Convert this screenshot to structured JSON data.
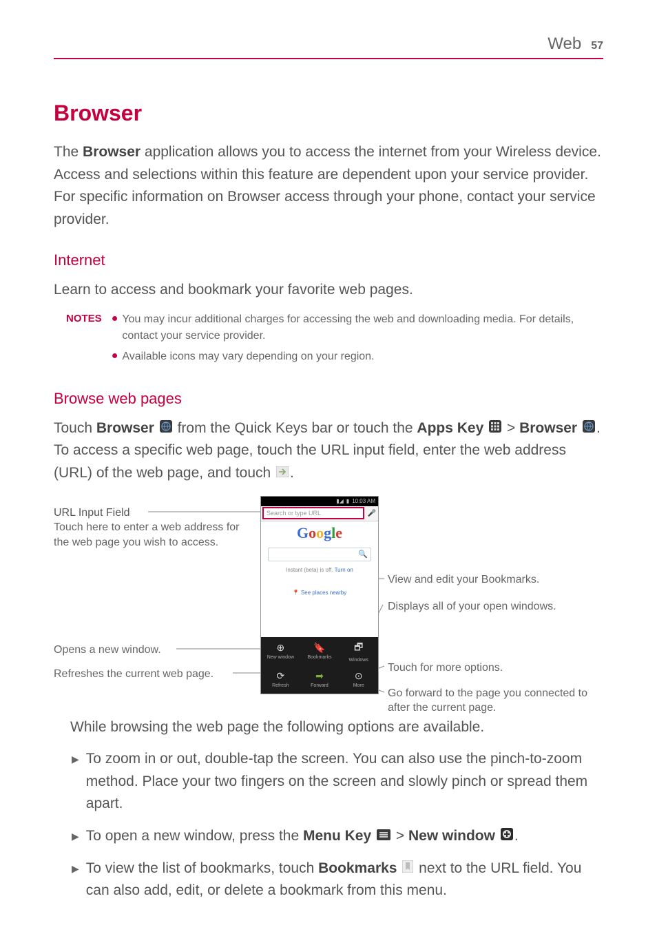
{
  "header": {
    "section": "Web",
    "page": "57"
  },
  "title": "Browser",
  "intro_parts": {
    "p1": "The ",
    "kw1": "Browser",
    "p2": " application allows you to access the internet from your Wireless device. Access and selections within this feature are dependent upon your service provider. For specific information on Browser access through your phone, contact your service provider."
  },
  "internet": {
    "heading": "Internet",
    "body": "Learn to access and bookmark your favorite web pages."
  },
  "notes": {
    "label": "NOTES",
    "items": [
      "You may incur additional charges for accessing the web and downloading media. For details, contact your service provider.",
      "Available icons may vary depending on your region."
    ]
  },
  "browse": {
    "heading": "Browse web pages",
    "line_parts": {
      "a": "Touch ",
      "kw1": "Browser",
      "b": " from the Quick Keys bar or touch the ",
      "kw2": "Apps Key",
      "c": " > ",
      "kw3": "Browser",
      "d": ".  To access a specific web page,  touch the URL input field, enter the web address (URL) of the web page, and touch ",
      "e": "."
    }
  },
  "phone": {
    "status_time": "10:03 AM",
    "url_placeholder": "Search or type URL",
    "instant_prefix": "Instant (beta) is off. ",
    "instant_link": "Turn on",
    "places": "See places nearby",
    "bottom": {
      "r1c1": "New window",
      "r1c2": "Bookmarks",
      "r1c3": "Windows",
      "r2c1": "Refresh",
      "r2c2": "Forward",
      "r2c3": "More"
    }
  },
  "callouts": {
    "url_title": "URL Input Field",
    "url_body": "Touch here to enter a web address for the web page you wish to access.",
    "new_window": "Opens a new window.",
    "refresh": "Refreshes the current web page.",
    "bookmarks": "View and edit your Bookmarks.",
    "windows": "Displays all of your open windows.",
    "more": "Touch for more options.",
    "forward": "Go forward to the page you connected to after the current page."
  },
  "after": {
    "intro": "While browsing the web page the following options are available.",
    "i1": "To zoom in or out, double-tap the screen. You can also use the pinch-to-zoom method. Place your two fingers on the screen and slowly pinch or spread them apart.",
    "i2_a": "To open a new window, press the ",
    "i2_kw1": "Menu Key",
    "i2_b": " > ",
    "i2_kw2": "New window",
    "i2_c": ".",
    "i3_a": "To view the list of bookmarks, touch ",
    "i3_kw1": "Bookmarks",
    "i3_b": " next to the URL field. You can also add, edit, or delete a bookmark from this menu."
  }
}
